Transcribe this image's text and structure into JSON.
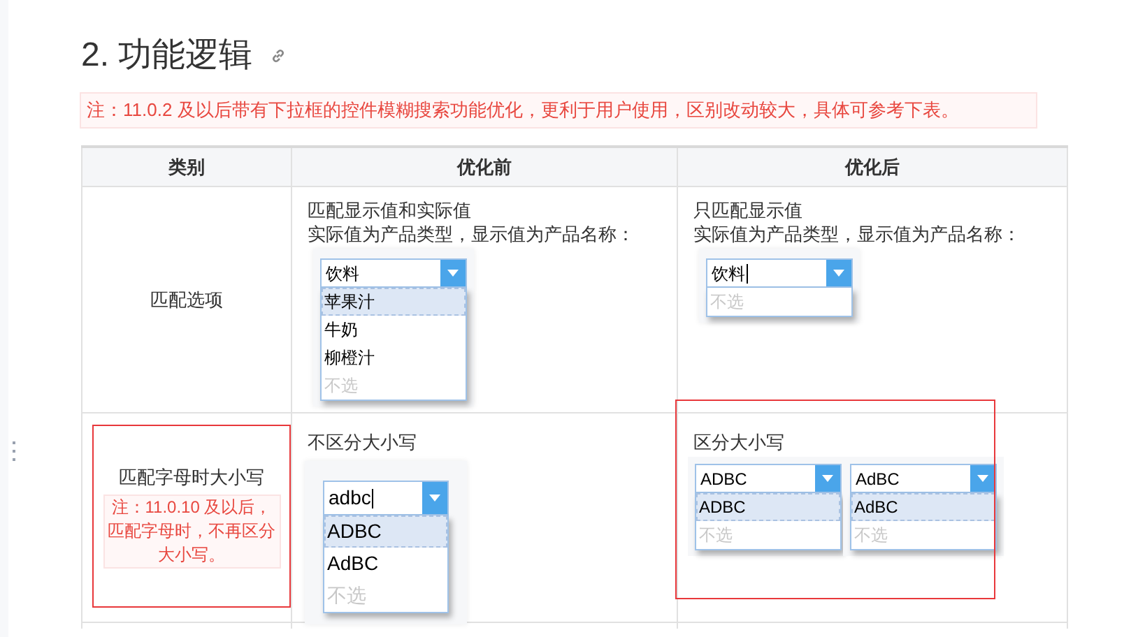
{
  "heading": {
    "text": "2. 功能逻辑"
  },
  "note": "注：11.0.2 及以后带有下拉框的控件模糊搜索功能优化，更利于用户使用，区别改动较大，具体可参考下表。",
  "table": {
    "columns": [
      "类别",
      "优化前",
      "优化后"
    ],
    "rows": [
      {
        "category": {
          "label": "匹配选项",
          "highlighted": false
        },
        "before": {
          "highlighted": false,
          "lines": [
            "匹配显示值和实际值",
            "实际值为产品类型，显示值为产品名称："
          ],
          "dropdowns": [
            {
              "value": "饮料",
              "focused": false,
              "options": [
                {
                  "label": "苹果汁",
                  "kind": "option",
                  "selected": true
                },
                {
                  "label": "牛奶",
                  "kind": "option",
                  "selected": false
                },
                {
                  "label": "柳橙汁",
                  "kind": "option",
                  "selected": false
                },
                {
                  "label": "不选",
                  "kind": "none",
                  "selected": false
                }
              ]
            }
          ]
        },
        "after": {
          "highlighted": false,
          "lines": [
            "只匹配显示值",
            "实际值为产品类型，显示值为产品名称："
          ],
          "dropdowns": [
            {
              "value": "饮料",
              "focused": true,
              "options": [
                {
                  "label": "不选",
                  "kind": "none",
                  "selected": false
                }
              ]
            }
          ]
        }
      },
      {
        "category": {
          "label": "匹配字母时大小写",
          "highlighted": true,
          "note": "注：11.0.10 及以后，匹配字母时，不再区分大小写。"
        },
        "before": {
          "highlighted": false,
          "lines": [
            "不区分大小写"
          ],
          "dropdowns": [
            {
              "value": "adbc",
              "focused": true,
              "options": [
                {
                  "label": "ADBC",
                  "kind": "option",
                  "selected": true
                },
                {
                  "label": "AdBC",
                  "kind": "option",
                  "selected": false
                },
                {
                  "label": "不选",
                  "kind": "none",
                  "selected": false
                }
              ]
            }
          ]
        },
        "after": {
          "highlighted": true,
          "lines": [
            "区分大小写"
          ],
          "dropdowns": [
            {
              "value": "ADBC",
              "focused": false,
              "options": [
                {
                  "label": "ADBC",
                  "kind": "option",
                  "selected": true
                },
                {
                  "label": "不选",
                  "kind": "none",
                  "selected": false
                }
              ]
            },
            {
              "value": "AdBC",
              "focused": false,
              "options": [
                {
                  "label": "AdBC",
                  "kind": "option",
                  "selected": true
                },
                {
                  "label": "不选",
                  "kind": "none",
                  "selected": false
                }
              ]
            }
          ]
        }
      }
    ]
  }
}
